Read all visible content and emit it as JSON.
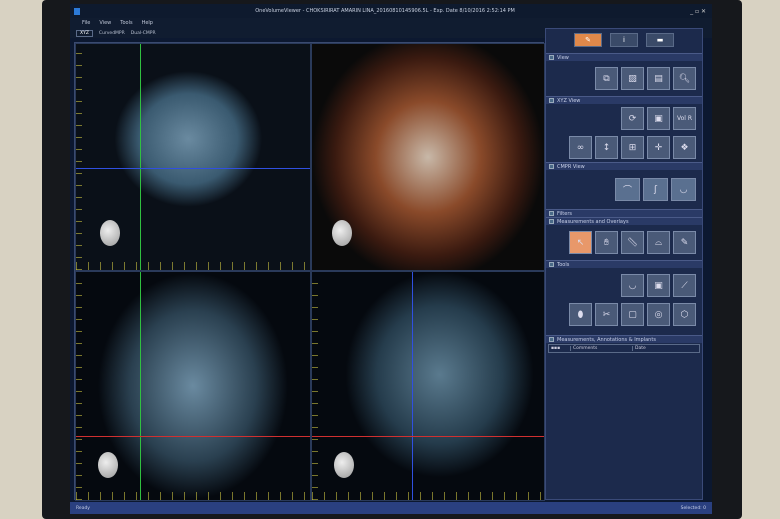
{
  "window": {
    "title": "OneVolumeViewer - CHOKSIRIRAT AMARIN LINA_20160810145906.5L - Exp. Date 8/10/2016 2:52:14 PM",
    "controls": "_ ▫ ✕"
  },
  "menu": [
    "File",
    "View",
    "Tools",
    "Help"
  ],
  "tabs": [
    "XYZ",
    "CurvedMPR",
    "Dual-CMPR"
  ],
  "panel": {
    "top_tabs": [
      "✎",
      "i",
      "▬"
    ],
    "sections": {
      "view": "View",
      "xyz": "XYZ View",
      "cmpr": "CMPR View",
      "filters": "Filters",
      "measure": "Measurements and Overlays",
      "tools": "Tools",
      "annot": "Measurements, Annotations & Implants"
    },
    "vol_button": "Vol R",
    "table_headers": [
      "Comments",
      "Date"
    ]
  },
  "status": {
    "left": "Ready",
    "right": "Selected: 0"
  },
  "colors": {
    "accent": "#e0884a",
    "panel": "#1c2a4c",
    "statusbar": "#2a4080"
  }
}
